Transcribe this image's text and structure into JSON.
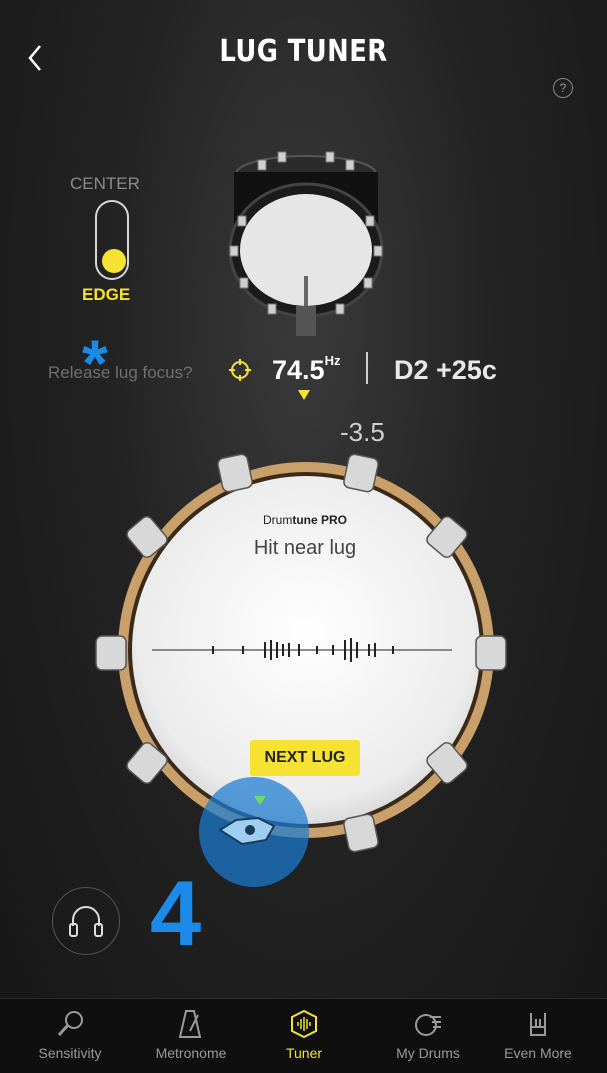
{
  "header": {
    "title": "LUG TUNER",
    "help_label": "?"
  },
  "toggle": {
    "top_label": "CENTER",
    "bottom_label": "EDGE",
    "selected": "EDGE"
  },
  "reading": {
    "release_text": "Release lug focus?",
    "frequency": "74.5",
    "unit": "Hz",
    "note": "D2 +25c",
    "offset": "-3.5"
  },
  "drum": {
    "brand_prefix": "Drum",
    "brand_bold": "tune PRO",
    "hint": "Hit near lug",
    "next_lug_label": "NEXT LUG"
  },
  "overlay": {
    "asterisk": "*",
    "number": "4"
  },
  "tabs": [
    {
      "label": "Sensitivity",
      "icon": "microphone-icon",
      "active": false
    },
    {
      "label": "Metronome",
      "icon": "metronome-icon",
      "active": false
    },
    {
      "label": "Tuner",
      "icon": "tuner-icon",
      "active": true
    },
    {
      "label": "My Drums",
      "icon": "drum-list-icon",
      "active": false
    },
    {
      "label": "Even More",
      "icon": "rock-hand-icon",
      "active": false
    }
  ],
  "colors": {
    "accent": "#f5e233",
    "overlay_blue": "#1a8be8",
    "background": "#1e1e1e"
  }
}
